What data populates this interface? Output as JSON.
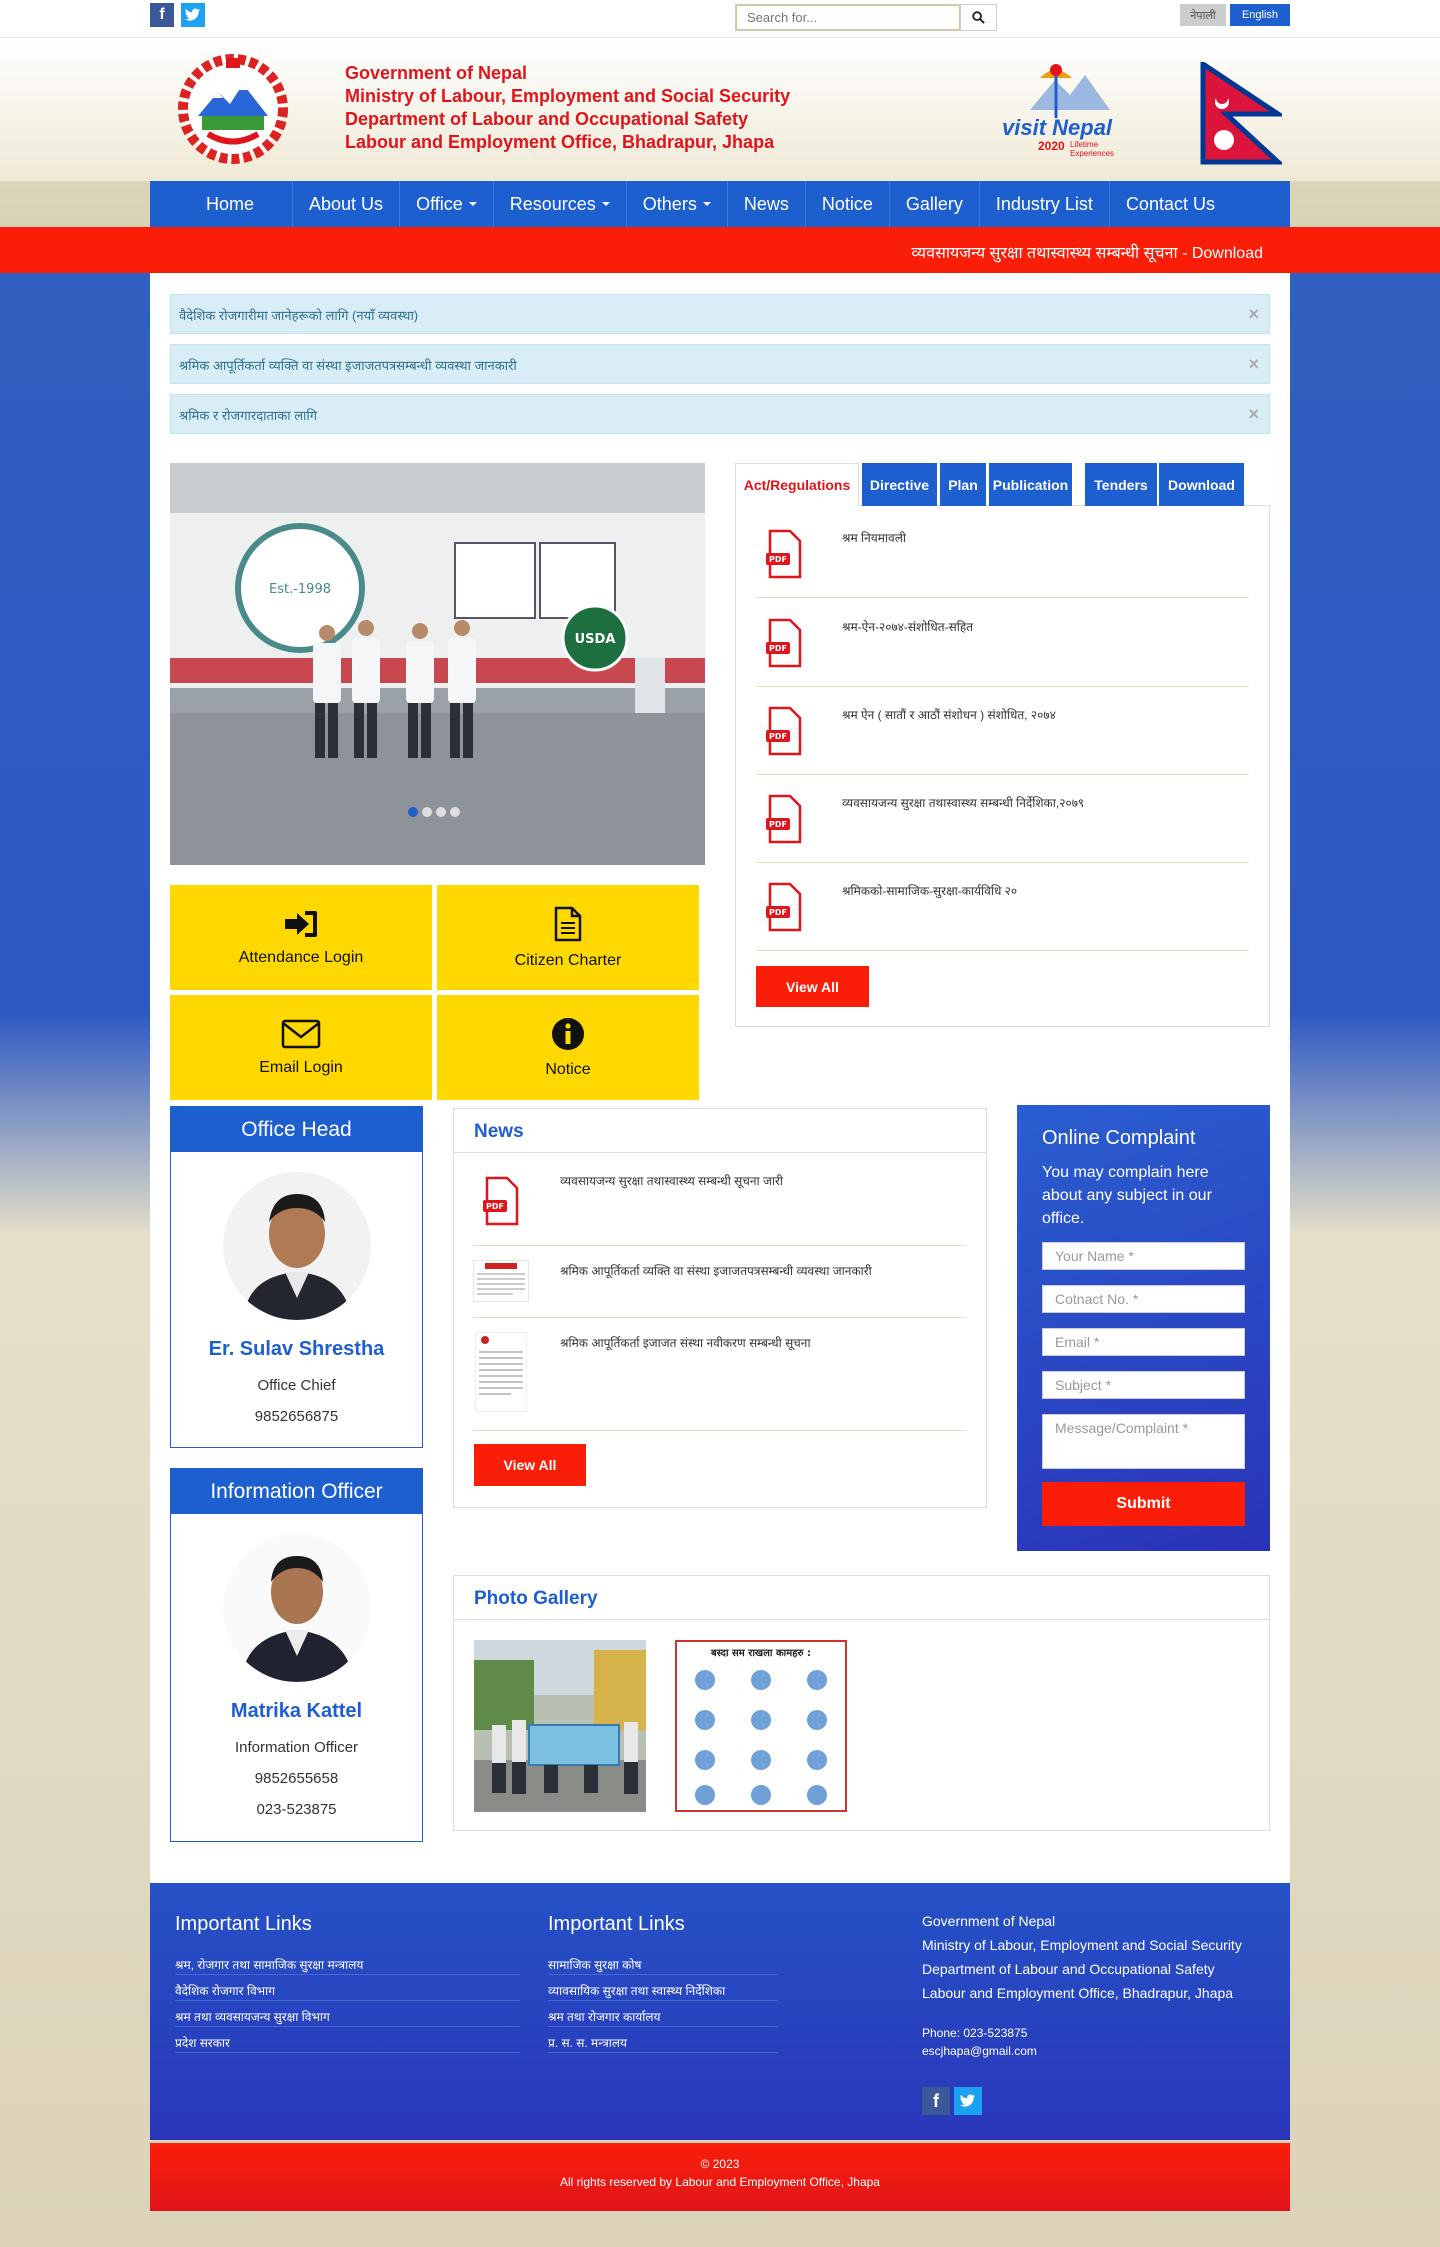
{
  "topbar": {
    "search_placeholder": "Search for...",
    "lang_nepali": "नेपाली",
    "lang_english": "English"
  },
  "header": {
    "line1": "Government of Nepal",
    "line2": "Ministry of Labour, Employment and Social Security",
    "line3": "Department of Labour and Occupational Safety",
    "line4": "Labour and Employment Office, Bhadrapur, Jhapa",
    "visit_nepal": "visit Nepal",
    "visit_year": "2020",
    "visit_tag": "Lifetime Experiences"
  },
  "nav": {
    "items": [
      "Home",
      "About Us",
      "Office",
      "Resources",
      "Others",
      "News",
      "Notice",
      "Gallery",
      "Industry List",
      "Contact Us"
    ]
  },
  "ticker": {
    "text": "व्यवसायजन्य सुरक्षा तथास्वास्थ्य सम्बन्धी सूचना - Download"
  },
  "alerts": [
    "वैदेशिक रोजगारीमा जानेहरूको लागि (नयाँ व्यवस्था)",
    "श्रमिक आपूर्तिकर्ता व्यक्ति वा संस्था इजाजतपत्रसम्बन्धी व्यवस्था जानकारी",
    "श्रमिक र रोजगारदाताका लागि"
  ],
  "tiles": {
    "attendance": "Attendance Login",
    "charter": "Citizen Charter",
    "email": "Email Login",
    "notice": "Notice"
  },
  "tabs": [
    "Act/Regulations",
    "Directive",
    "Plan",
    "Publication",
    "Tenders",
    "Download"
  ],
  "docs": [
    "श्रम नियमावली",
    "श्रम-ऐन-२०७४-संशोधित-सहित",
    "श्रम ऐन ( सातौं र आठौं संशोधन ) संशोधित, २०७४",
    "व्यवसायजन्य सुरक्षा तथास्वास्थ्य सम्बन्धी निर्देशिका,२०७९",
    "श्रमिकको-सामाजिक-सुरक्षा-कार्यविधि २०"
  ],
  "view_all": "View All",
  "office_head": {
    "title": "Office Head",
    "name": "Er. Sulav Shrestha",
    "role": "Office Chief",
    "phone": "9852656875"
  },
  "info_officer": {
    "title": "Information Officer",
    "name": "Matrika Kattel",
    "role": "Information Officer",
    "phone": "9852655658",
    "phone2": "023-523875"
  },
  "news": {
    "title": "News",
    "items": [
      "व्यवसायजन्य सुरक्षा तथास्वास्थ्य सम्बन्धी सूचना जारी",
      "श्रमिक आपूर्तिकर्ता व्यक्ति वा संस्था इजाजतपत्रसम्बन्धी व्यवस्था जानकारी",
      "श्रमिक आपूर्तिकर्ता इजाजत संस्था नवीकरण सम्बन्धी सूचना"
    ]
  },
  "complaint": {
    "title": "Online Complaint",
    "desc": "You may complain here about any subject in our office.",
    "name_ph": "Your Name *",
    "contact_ph": "Cotnact No. *",
    "email_ph": "Email *",
    "subject_ph": "Subject *",
    "message_ph": "Message/Complaint *",
    "submit": "Submit"
  },
  "gallery": {
    "title": "Photo Gallery",
    "poster_heading": "बस्दा सम राखला कामहरु :"
  },
  "footer": {
    "links1_title": "Important Links",
    "links1": [
      "श्रम, रोजगार तथा सामाजिक सुरक्षा मन्त्रालय",
      "वैदेशिक रोजगार विभाग",
      "श्रम तथा व्यवसायजन्य सुरक्षा विभाग",
      "प्रदेश सरकार"
    ],
    "links2_title": "Important Links",
    "links2": [
      "सामाजिक सुरक्षा कोष",
      "व्यावसायिक सुरक्षा तथा स्वास्थ्य निर्देशिका",
      "श्रम तथा रोजगार कार्यालय",
      "प्र. स. स. मन्त्रालय"
    ],
    "addr1": "Government of Nepal",
    "addr2": "Ministry of Labour, Employment and Social Security",
    "addr3": "Department of Labour and Occupational Safety",
    "addr4": "Labour and Employment Office, Bhadrapur, Jhapa",
    "phone": "Phone: 023-523875",
    "email": "escjhapa@gmail.com",
    "copyright_year": "© 2023",
    "copyright": "All rights reserved by Labour and Employment Office, Jhapa"
  },
  "colors": {
    "primary": "#1e5fcf",
    "accent": "#fa1e09",
    "tile": "#ffd800"
  }
}
